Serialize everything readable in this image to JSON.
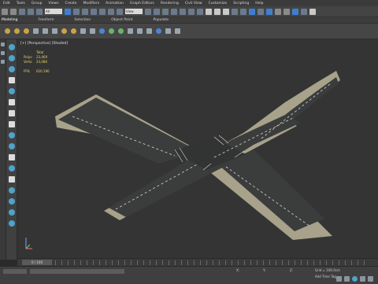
{
  "menubar": {
    "items": [
      "Edit",
      "Tools",
      "Group",
      "Views",
      "Create",
      "Modifiers",
      "Animation",
      "Graph Editors",
      "Rendering",
      "Civil View",
      "Customize",
      "Scripting",
      "Help"
    ]
  },
  "toolbar1": {
    "selection_set": "All",
    "view_dropdown": "View"
  },
  "ribbon": {
    "tabs": [
      "Modeling",
      "Freeform",
      "Selection",
      "Object Paint",
      "Populate"
    ]
  },
  "viewport": {
    "label": "[+] [Perspective] [Shaded]",
    "stats": {
      "header": "Total",
      "polys_label": "Polys:",
      "polys_value": "23,469",
      "verts_label": "Verts:",
      "verts_value": "23,086",
      "fps_label": "FPS:",
      "fps_value": "620.190"
    }
  },
  "timeline": {
    "frame": "0 / 100"
  },
  "statusbar": {
    "x_label": "X:",
    "y_label": "Y:",
    "z_label": "Z:",
    "grid": "Grid = 100.0cm",
    "add_time_tag": "Add Time Tag"
  },
  "colors": {
    "asphalt": "#3b3d3d",
    "sidewalk": "#a8a28a",
    "lane_mark": "#d8d8d0",
    "viewport_bg": "#343434"
  }
}
